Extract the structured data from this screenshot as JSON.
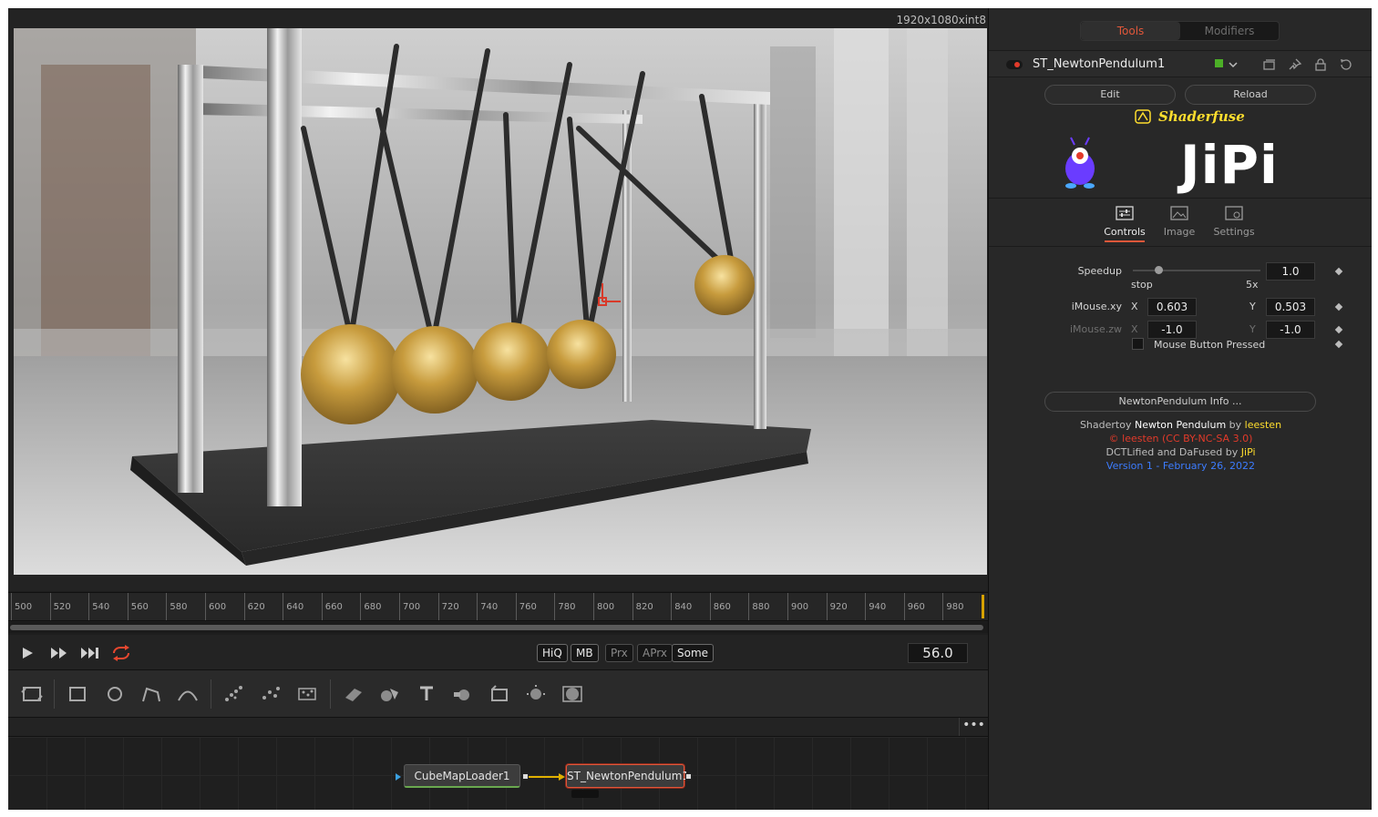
{
  "viewer": {
    "resolution_label": "1920x1080xint8"
  },
  "ruler": {
    "ticks": [
      "500",
      "520",
      "540",
      "560",
      "580",
      "600",
      "620",
      "640",
      "660",
      "680",
      "700",
      "720",
      "740",
      "760",
      "780",
      "800",
      "820",
      "840",
      "860",
      "880",
      "900",
      "920",
      "940",
      "960",
      "980"
    ]
  },
  "transport": {
    "play_icon": "play-icon",
    "fast_forward_icon": "fast-forward-icon",
    "skip_end_icon": "skip-to-end-icon",
    "loop_icon": "loop-icon",
    "hiq": "HiQ",
    "mb": "MB",
    "prx": "Prx",
    "aprx": "APrx",
    "some": "Some",
    "current_frame": "56.0"
  },
  "toolbar": {
    "icons": [
      "transform-icon",
      "rectangle-mask-icon",
      "ellipse-mask-icon",
      "polygon-mask-icon",
      "bspline-mask-icon",
      "particle-emitter-icon",
      "particle-render-icon",
      "particle-lab-icon",
      "shape3d-icon",
      "merge3d-icon",
      "text3d-icon",
      "renderer3d-icon",
      "camera3d-icon",
      "light3d-icon",
      "image-plane-icon"
    ]
  },
  "flow": {
    "more_label": "•••",
    "node1": "CubeMapLoader1",
    "node2": "ST_NewtonPendulum1"
  },
  "inspector": {
    "tab_tools": "Tools",
    "tab_modifiers": "Modifiers",
    "node_title": "ST_NewtonPendulum1",
    "edit_button": "Edit",
    "reload_button": "Reload",
    "shaderfuse_label": "Shaderfuse",
    "logo_text": "JiPi",
    "control_tabs": {
      "controls": "Controls",
      "image": "Image",
      "settings": "Settings"
    },
    "speedup": {
      "label": "Speedup",
      "value": "1.0",
      "min_label": "stop",
      "max_label": "5x",
      "slider_fraction": 0.1
    },
    "imouse_xy": {
      "label": "iMouse.xy",
      "x_label": "X",
      "x_value": "0.603",
      "y_label": "Y",
      "y_value": "0.503"
    },
    "imouse_zw": {
      "label": "iMouse.zw",
      "x_label": "X",
      "x_value": "-1.0",
      "y_label": "Y",
      "y_value": "-1.0"
    },
    "mouse_pressed_label": "Mouse Button Pressed",
    "info_button": "NewtonPendulum Info ...",
    "credits": {
      "line1_prefix": "Shadertoy ",
      "line1_title": "Newton Pendulum",
      "line1_by": " by ",
      "line1_author": "leesten",
      "line2": "© leesten (CC BY-NC-SA 3.0)",
      "line3_prefix": "DCTLified and DaFused by ",
      "line3_author": "JiPi",
      "line4": "Version 1 - February 26, 2022"
    }
  },
  "colors": {
    "accent_red": "#e0573a",
    "gold": "#ffde2e",
    "link_blue": "#3c7cff",
    "node_green": "#4caf27"
  }
}
